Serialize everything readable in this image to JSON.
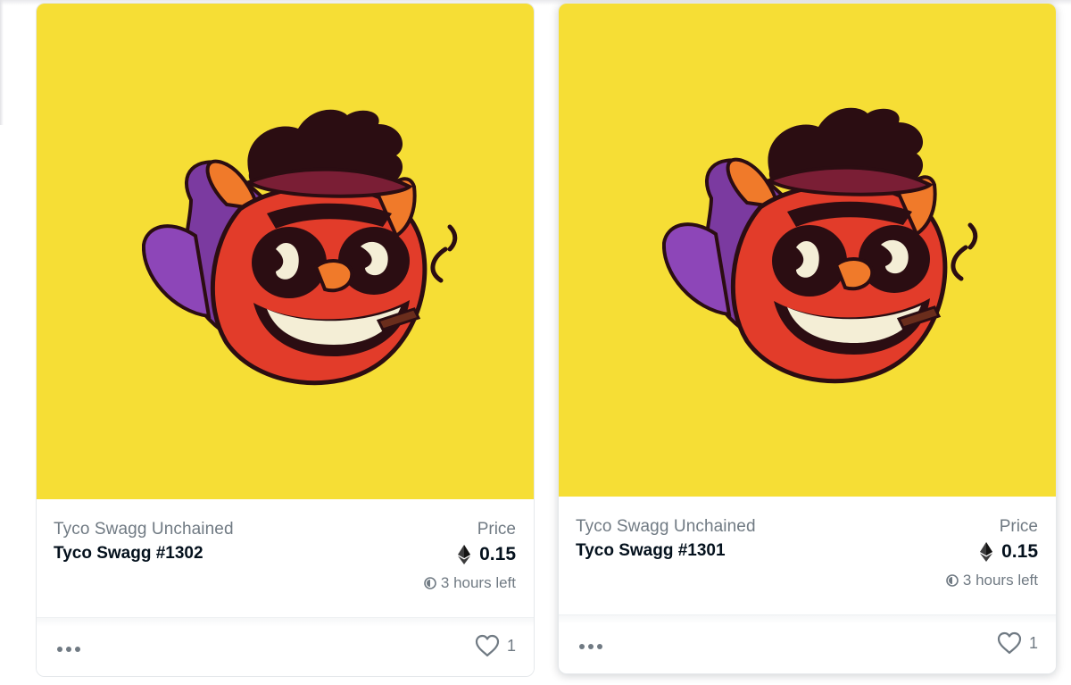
{
  "colors": {
    "artwork_background": "#f6de35",
    "primary_text": "#04111d",
    "secondary_text": "#707a83"
  },
  "cards": [
    {
      "collection": "Tyco Swagg Unchained",
      "name": "Tyco Swagg #1302",
      "price_label": "Price",
      "price": "0.15",
      "currency_icon": "ethereum-icon",
      "time_left": "3 hours left",
      "likes": "1",
      "menu_icon": "more-dots-icon",
      "like_icon": "heart-icon"
    },
    {
      "collection": "Tyco Swagg Unchained",
      "name": "Tyco Swagg #1301",
      "price_label": "Price",
      "price": "0.15",
      "currency_icon": "ethereum-icon",
      "time_left": "3 hours left",
      "likes": "1",
      "menu_icon": "more-dots-icon",
      "like_icon": "heart-icon"
    }
  ]
}
